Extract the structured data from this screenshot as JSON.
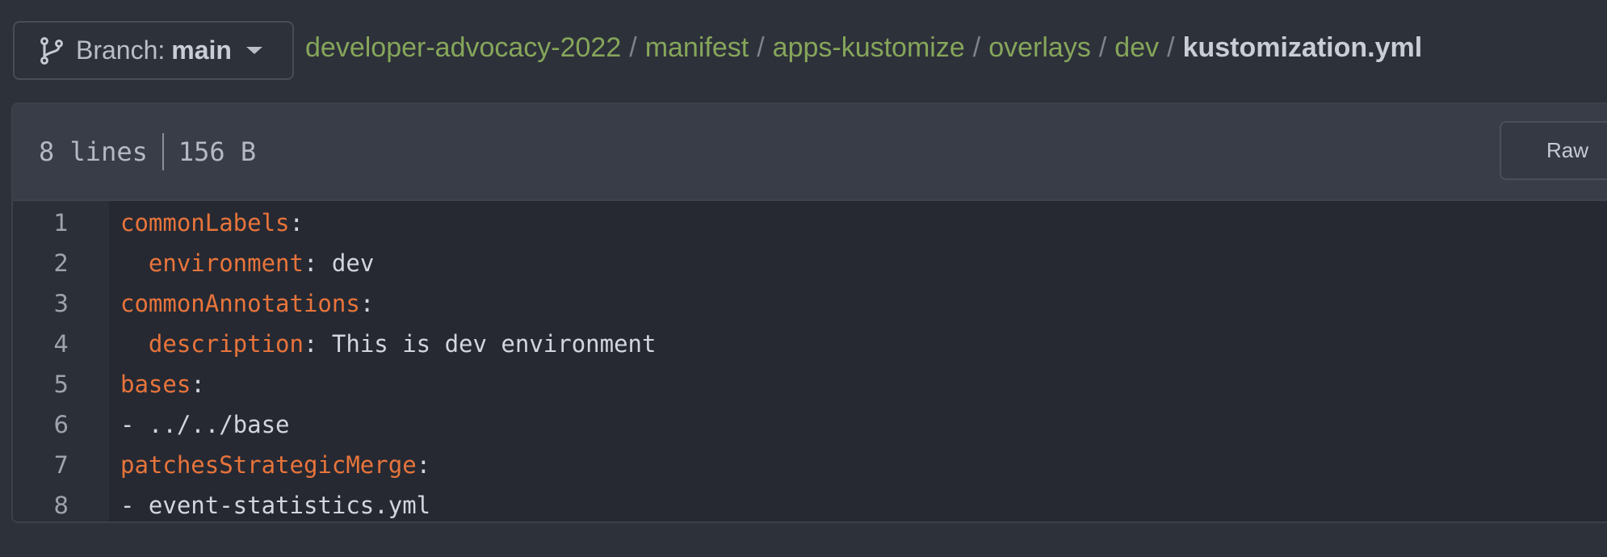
{
  "branch": {
    "label": "Branch:",
    "name": "main",
    "icon": "git-branch-icon"
  },
  "breadcrumb": {
    "items": [
      "developer-advocacy-2022",
      "manifest",
      "apps-kustomize",
      "overlays",
      "dev"
    ],
    "separator": "/",
    "current": "kustomization.yml"
  },
  "file": {
    "lines_count": "8 lines",
    "size": "156 B",
    "raw_label": "Raw"
  },
  "code": {
    "lines": [
      {
        "num": "1",
        "indent": "",
        "key": "commonLabels",
        "sep": ":",
        "value": ""
      },
      {
        "num": "2",
        "indent": "  ",
        "key": "environment",
        "sep": ":",
        "value": " dev"
      },
      {
        "num": "3",
        "indent": "",
        "key": "commonAnnotations",
        "sep": ":",
        "value": ""
      },
      {
        "num": "4",
        "indent": "  ",
        "key": "description",
        "sep": ":",
        "value": " This is dev environment"
      },
      {
        "num": "5",
        "indent": "",
        "key": "bases",
        "sep": ":",
        "value": ""
      },
      {
        "num": "6",
        "indent": "",
        "key": "",
        "sep": "",
        "value": "- ../../base"
      },
      {
        "num": "7",
        "indent": "",
        "key": "patchesStrategicMerge",
        "sep": ":",
        "value": ""
      },
      {
        "num": "8",
        "indent": "",
        "key": "",
        "sep": "",
        "value": "- event-statistics.yml"
      }
    ]
  },
  "colors": {
    "link": "#86a65a",
    "yaml_key": "#e8743b",
    "code_bg": "#262932",
    "page_bg": "#2d313a"
  }
}
